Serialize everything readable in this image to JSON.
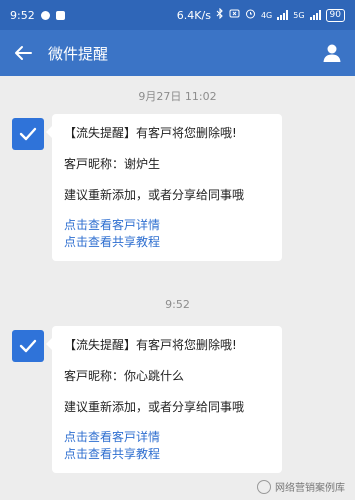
{
  "status": {
    "time": "9:52",
    "speed": "6.4K/s",
    "network1": "4G",
    "network2": "5G",
    "battery": "90"
  },
  "header": {
    "title": "微件提醒"
  },
  "messages": [
    {
      "time": "9月27日 11:02",
      "headline": "【流失提醒】有客戸将您删除哦!",
      "nickname": "客戸昵称：谢炉生",
      "suggestion": "建议重新添加，或者分享给同事哦",
      "link1": "点击查看客戸详情",
      "link2": "点击查看共享教程"
    },
    {
      "time": "9:52",
      "headline": "【流失提醒】有客戸将您删除哦!",
      "nickname": "客戸昵称：你心跳什么",
      "suggestion": "建议重新添加，或者分享给同事哦",
      "link1": "点击查看客戸详情",
      "link2": "点击查看共享教程"
    }
  ],
  "watermark": {
    "text": "网络营销案例库"
  },
  "colors": {
    "appbar": "#3b74c6",
    "statusbar": "#2f66b8",
    "link": "#2f6fd0",
    "avatar": "#2f73d9",
    "background": "#ededed"
  }
}
